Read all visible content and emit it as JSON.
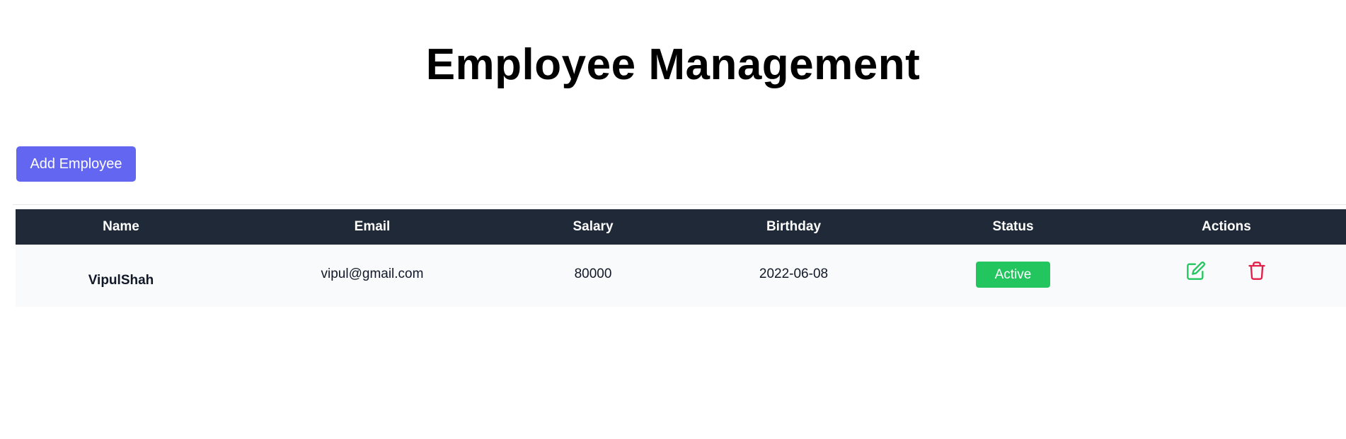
{
  "header": {
    "title": "Employee Management"
  },
  "toolbar": {
    "add_label": "Add Employee",
    "accent_color": "#6366f1"
  },
  "table": {
    "columns": [
      "Name",
      "Email",
      "Salary",
      "Birthday",
      "Status",
      "Actions"
    ],
    "header_bg": "#1f2937",
    "rows": [
      {
        "name": "VipulShah",
        "email": "vipul@gmail.com",
        "salary": "80000",
        "birthday": "2022-06-08",
        "status": "Active",
        "status_color": "#22c55e",
        "edit_icon": "edit-icon",
        "edit_color": "#22c55e",
        "delete_icon": "trash-icon",
        "delete_color": "#e11d48"
      }
    ]
  }
}
